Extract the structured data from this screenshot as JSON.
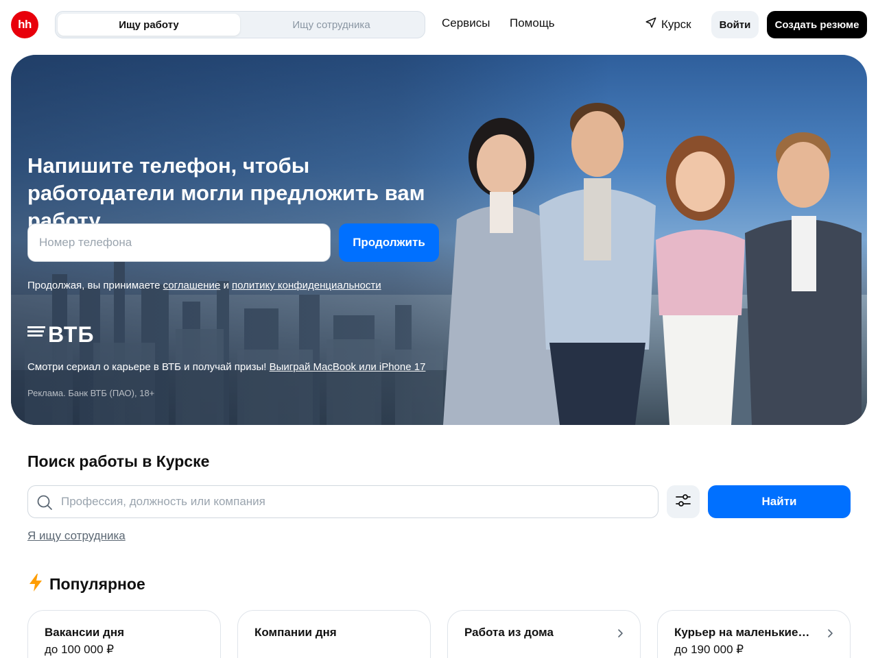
{
  "header": {
    "logo": "hh",
    "role_tabs": [
      {
        "label": "Ищу работу",
        "active": true
      },
      {
        "label": "Ищу сотрудника",
        "active": false
      }
    ],
    "nav": [
      "Сервисы",
      "Помощь"
    ],
    "city": "Курск",
    "login": "Войти",
    "create_resume": "Создать резюме"
  },
  "banner": {
    "title": "Напишите телефон, чтобы работодатели могли предложить вам работу",
    "phone_placeholder": "Номер телефона",
    "continue": "Продолжить",
    "agree_prefix": "Продолжая, вы принимаете",
    "agree_link1": "соглашение",
    "agree_and": "и",
    "agree_link2": "политику конфиденциальности",
    "brand": "ВТБ",
    "promo_text": "Смотри сериал о карьере в ВТБ и получай призы!",
    "promo_link": "Выиграй MacBook или iPhone 17",
    "ad_note": "Реклама. Банк ВТБ (ПАО), 18+"
  },
  "search": {
    "title": "Поиск работы в Курске",
    "placeholder": "Профессия, должность или компания",
    "find": "Найти",
    "employer_link": "Я ищу сотрудника"
  },
  "popular": {
    "title": "Популярное",
    "cards": [
      {
        "title": "Вакансии дня",
        "subtitle": "до 100 000 ₽",
        "chevron": false
      },
      {
        "title": "Компании дня",
        "subtitle": "",
        "chevron": false
      },
      {
        "title": "Работа из дома",
        "subtitle": "",
        "chevron": true
      },
      {
        "title": "Курьер на маленькие…",
        "subtitle": "до 190 000 ₽",
        "chevron": true
      }
    ]
  },
  "colors": {
    "brand_red": "#e8000b",
    "primary_blue": "#0070ff",
    "accent_orange": "#ff9d00"
  }
}
